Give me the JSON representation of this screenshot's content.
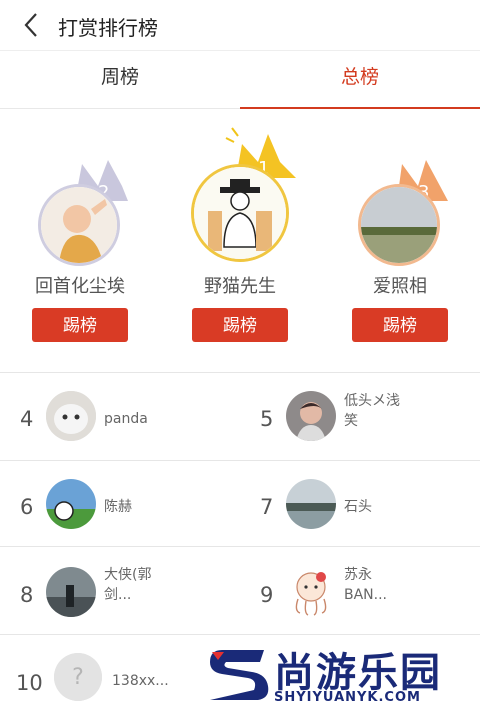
{
  "header": {
    "title": "打赏排行榜"
  },
  "tabs": [
    {
      "label": "周榜",
      "active": false
    },
    {
      "label": "总榜",
      "active": true
    }
  ],
  "accent_color": "#d33b1f",
  "podium": [
    {
      "rank": "2",
      "name": "回首化尘埃",
      "button": "踢榜"
    },
    {
      "rank": "1",
      "name": "野猫先生",
      "button": "踢榜"
    },
    {
      "rank": "3",
      "name": "爱照相",
      "button": "踢榜"
    }
  ],
  "list": [
    {
      "rank": "4",
      "name": "panda"
    },
    {
      "rank": "5",
      "name": "低头メ浅\n笑"
    },
    {
      "rank": "6",
      "name": "陈赫"
    },
    {
      "rank": "7",
      "name": "石头"
    },
    {
      "rank": "8",
      "name": "大侠(郭\n剑..."
    },
    {
      "rank": "9",
      "name": "苏永\nBAN..."
    },
    {
      "rank": "10",
      "name": "138xx..."
    }
  ],
  "watermark": {
    "text": "尚游乐园",
    "url": "SHYIYUANYK.COM"
  }
}
